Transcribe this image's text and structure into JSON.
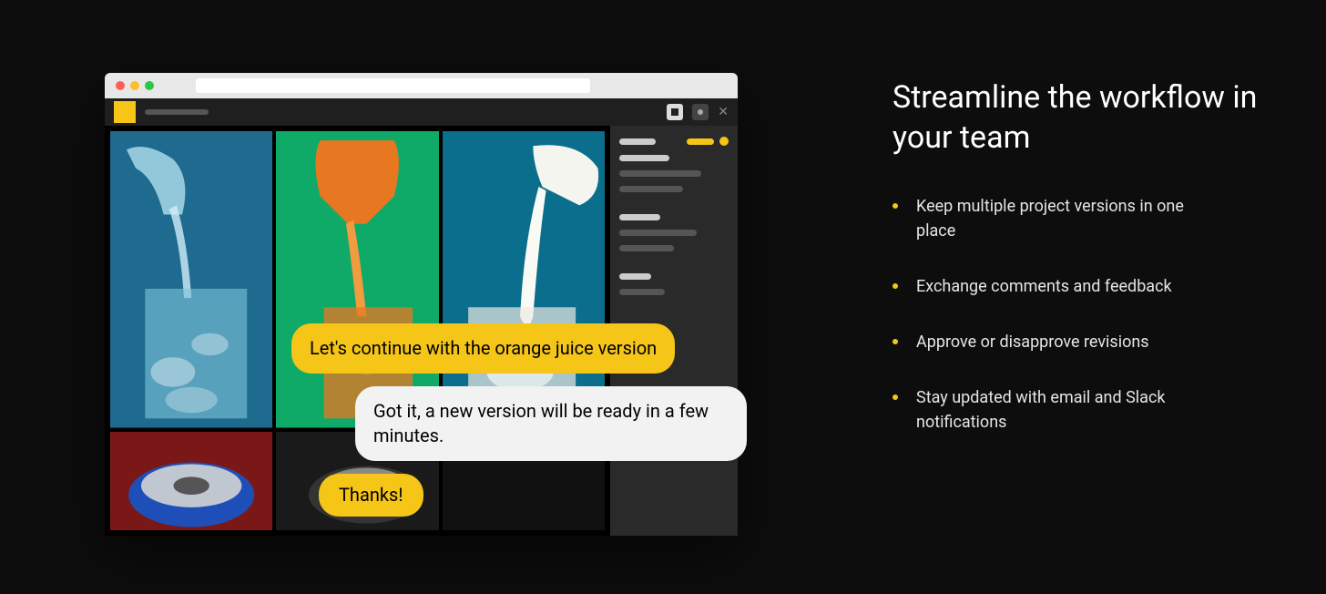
{
  "heading": "Streamline the workflow in your team",
  "features": [
    "Keep multiple project versions in one place",
    "Exchange comments and feedback",
    "Approve or disapprove revisions",
    "Stay updated with email and Slack notifications"
  ],
  "chat": {
    "msg1": "Let's continue with the orange juice version",
    "msg2": "Got it, a new version will be ready in a few minutes.",
    "msg3": "Thanks!"
  },
  "colors": {
    "accent": "#f5c518",
    "bg": "#0d0d0d"
  }
}
